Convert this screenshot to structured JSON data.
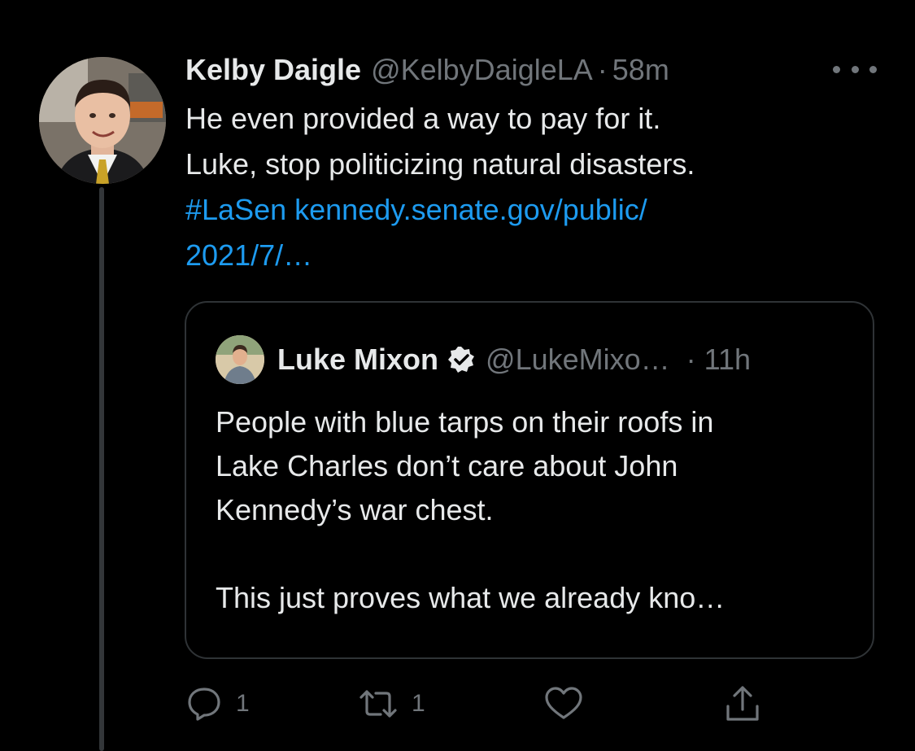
{
  "tweet": {
    "author_name": "Kelby Daigle",
    "author_handle": "@KelbyDaigleLA",
    "separator": "·",
    "time": "58m",
    "text_lines": [
      "He even provided a way to pay for it.",
      "Luke, stop politicizing natural disasters."
    ],
    "hashtag": "#LaSen",
    "link_part1": "kennedy.senate.gov/public/",
    "link_part2": "2021/7/…",
    "more_icon": "more-horizontal-icon",
    "avatar_icon": "profile-photo"
  },
  "quote": {
    "author_name": "Luke Mixon",
    "verified_icon": "verified-badge-icon",
    "author_handle": "@LukeMixo…",
    "time": "· 11h",
    "text_lines": [
      "People with blue tarps on their roofs in",
      "Lake Charles don’t care about John",
      "Kennedy’s war chest.",
      "",
      "This just proves what we already kno…"
    ]
  },
  "actions": {
    "reply_count": "1",
    "retweet_count": "1",
    "like_count": "",
    "share_label": ""
  },
  "colors": {
    "background": "#000000",
    "text": "#e7e9ea",
    "muted": "#71767b",
    "link": "#1d9bf0",
    "border": "#2f3336"
  }
}
